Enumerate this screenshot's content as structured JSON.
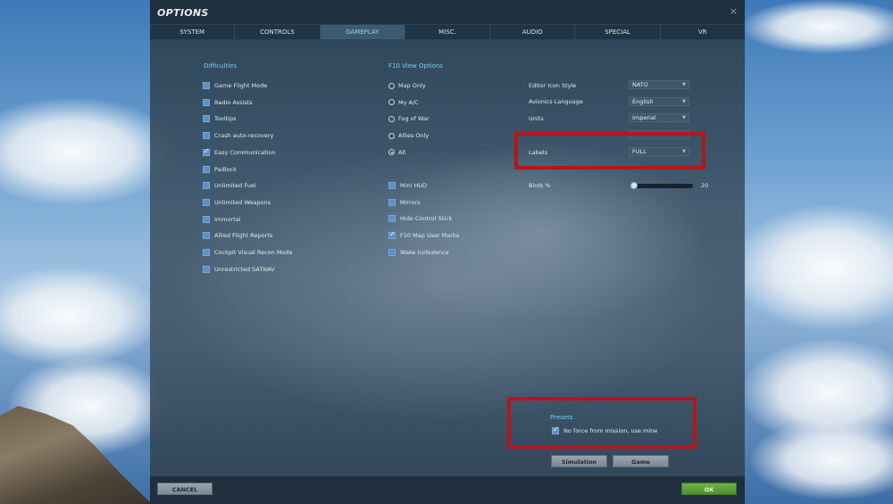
{
  "window": {
    "title": "OPTIONS",
    "close_glyph": "×"
  },
  "tabs": [
    {
      "label": "SYSTEM",
      "active": false
    },
    {
      "label": "CONTROLS",
      "active": false
    },
    {
      "label": "GAMEPLAY",
      "active": true
    },
    {
      "label": "MISC.",
      "active": false
    },
    {
      "label": "AUDIO",
      "active": false
    },
    {
      "label": "SPECIAL",
      "active": false
    },
    {
      "label": "VR",
      "active": false
    }
  ],
  "difficulties": {
    "heading": "Difficulties",
    "items": [
      {
        "label": "Game Flight Mode",
        "checked": false
      },
      {
        "label": "Radio Assists",
        "checked": false
      },
      {
        "label": "Tooltips",
        "checked": false
      },
      {
        "label": "Crash auto-recovery",
        "checked": false
      },
      {
        "label": "Easy Communication",
        "checked": true
      },
      {
        "label": "Padlock",
        "checked": false
      },
      {
        "label": "Unlimited Fuel",
        "checked": false
      },
      {
        "label": "Unlimited Weapons",
        "checked": false
      },
      {
        "label": "Immortal",
        "checked": false
      },
      {
        "label": "Allied Flight Reports",
        "checked": false
      },
      {
        "label": "Cockpit Visual Recon Mode",
        "checked": false
      },
      {
        "label": "Unrestricted SATNAV",
        "checked": false
      }
    ]
  },
  "f10_view": {
    "heading": "F10 View Options",
    "radios": [
      {
        "label": "Map Only",
        "selected": false
      },
      {
        "label": "My A/C",
        "selected": false
      },
      {
        "label": "Fog of War",
        "selected": false
      },
      {
        "label": "Allies Only",
        "selected": false
      },
      {
        "label": "All",
        "selected": true
      }
    ],
    "checks": [
      {
        "label": "Mini HUD",
        "checked": false
      },
      {
        "label": "Mirrors",
        "checked": false
      },
      {
        "label": "Hide Control Stick",
        "checked": false
      },
      {
        "label": "F10 Map User Marks",
        "checked": true
      },
      {
        "label": "Wake turbulence",
        "checked": false
      }
    ]
  },
  "settings": {
    "editor_icon_style": {
      "label": "Editor Icon Style",
      "value": "NATO"
    },
    "avionics_language": {
      "label": "Avionics Language",
      "value": "English"
    },
    "units": {
      "label": "Units",
      "value": "Imperial"
    },
    "labels": {
      "label": "Labels",
      "value": "FULL"
    },
    "birds": {
      "label": "Birds %",
      "value": "20",
      "level": 0.02
    }
  },
  "presets": {
    "heading": "Presets",
    "no_force_label": "No force from mission, use mine",
    "no_force_checked": true,
    "simulation_button": "Simulation",
    "game_button": "Game"
  },
  "footer": {
    "cancel_label": "CANCEL",
    "ok_label": "OK"
  },
  "colors": {
    "highlight_box": "#b3171b",
    "accent_text": "#71d2ee",
    "ok_green": "#5aa03a"
  }
}
